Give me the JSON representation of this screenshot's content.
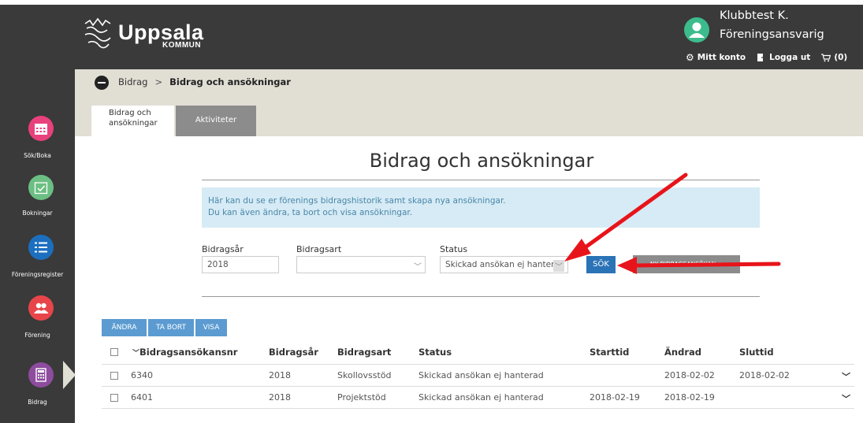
{
  "header": {
    "logo_text": "Uppsala",
    "logo_sub": "KOMMUN",
    "user_name": "Klubbtest K.",
    "user_role": "Föreningsansvarig",
    "account_label": "Mitt konto",
    "logout_label": "Logga ut",
    "cart_label": "(0)"
  },
  "sidebar": {
    "items": [
      {
        "label": "Sök/Boka",
        "color": "#e8417c",
        "icon": "calendar-icon"
      },
      {
        "label": "Bokningar",
        "color": "#6cbf84",
        "icon": "calendar-check-icon"
      },
      {
        "label": "Föreningsregister",
        "color": "#1c6fbf",
        "icon": "list-icon"
      },
      {
        "label": "Förening",
        "color": "#e8454a",
        "icon": "users-icon"
      },
      {
        "label": "Bidrag",
        "color": "#8e4c9e",
        "icon": "calculator-icon"
      }
    ]
  },
  "breadcrumb": {
    "parent": "Bidrag",
    "separator": ">",
    "current": "Bidrag och ansökningar"
  },
  "tabs": {
    "active_line1": "Bidrag och",
    "active_line2": "ansökningar",
    "inactive": "Aktiviteter"
  },
  "main": {
    "title": "Bidrag och ansökningar",
    "info_line1": "Här kan du se er förenings bidragshistorik samt skapa nya ansökningar.",
    "info_line2": "Du kan även ändra, ta bort och visa ansökningar."
  },
  "form": {
    "year_label": "Bidragsår",
    "year_value": "2018",
    "type_label": "Bidragsart",
    "type_value": "",
    "status_label": "Status",
    "status_value": "Skickad ansökan ej hanterad",
    "search_label": "SÖK",
    "new_label": "NY BIDRAGSANSÖKAN +"
  },
  "actions": {
    "edit": "ÄNDRA",
    "delete": "TA BORT",
    "view": "VISA"
  },
  "table": {
    "columns": [
      "Bidragsansökansnr",
      "Bidragsår",
      "Bidragsart",
      "Status",
      "Starttid",
      "Ändrad",
      "Sluttid"
    ],
    "rows": [
      {
        "nr": "6340",
        "year": "2018",
        "type": "Skollovsstöd",
        "status": "Skickad ansökan ej hanterad",
        "start": "",
        "changed": "2018-02-02",
        "end": "2018-02-02"
      },
      {
        "nr": "6401",
        "year": "2018",
        "type": "Projektstöd",
        "status": "Skickad ansökan ej hanterad",
        "start": "2018-02-19",
        "changed": "2018-02-19",
        "end": ""
      }
    ]
  }
}
